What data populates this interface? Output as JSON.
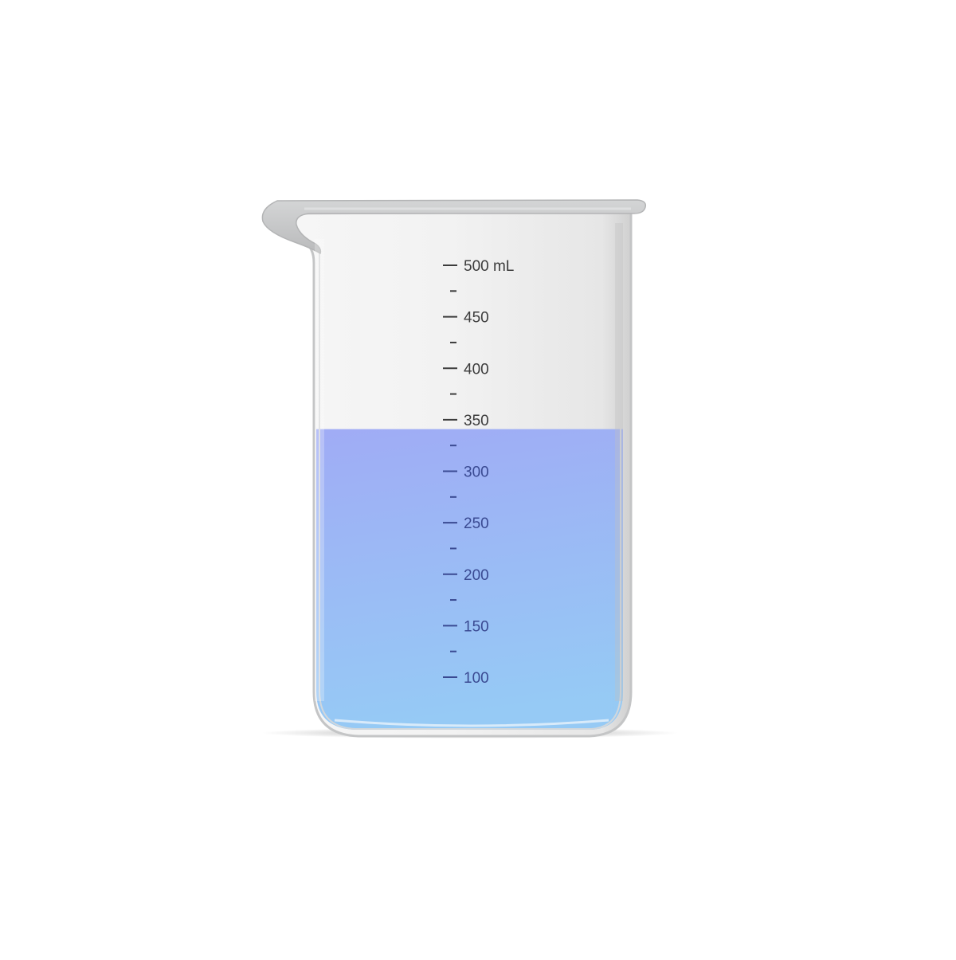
{
  "beaker": {
    "capacity_ml": 500,
    "fill_ml": 320,
    "liquid_color_top": "#9eaaf5",
    "liquid_color_bottom": "#94c9f5",
    "glass_color": "#ececec",
    "rim_color": "#c9cacb",
    "mark_color_dry": "#3c3c3c",
    "mark_color_wet": "#3a4a92"
  },
  "graduations": [
    {
      "value": 500,
      "label": "500 mL"
    },
    {
      "value": 475,
      "label": ""
    },
    {
      "value": 450,
      "label": "450"
    },
    {
      "value": 425,
      "label": ""
    },
    {
      "value": 400,
      "label": "400"
    },
    {
      "value": 375,
      "label": ""
    },
    {
      "value": 350,
      "label": "350"
    },
    {
      "value": 325,
      "label": ""
    },
    {
      "value": 300,
      "label": "300"
    },
    {
      "value": 275,
      "label": ""
    },
    {
      "value": 250,
      "label": "250"
    },
    {
      "value": 225,
      "label": ""
    },
    {
      "value": 200,
      "label": "200"
    },
    {
      "value": 175,
      "label": ""
    },
    {
      "value": 150,
      "label": "150"
    },
    {
      "value": 125,
      "label": ""
    },
    {
      "value": 100,
      "label": "100"
    }
  ]
}
